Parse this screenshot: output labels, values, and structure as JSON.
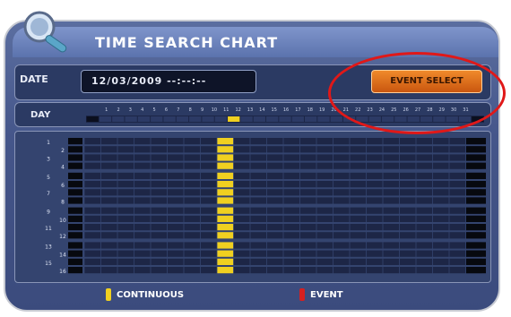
{
  "window": {
    "title": "TIME SEARCH CHART"
  },
  "date": {
    "label": "DATE",
    "value": "12/03/2009 --:--:--"
  },
  "event_select": {
    "label": "EVENT SELECT"
  },
  "day": {
    "label": "DAY",
    "numbers": [
      "1",
      "2",
      "3",
      "4",
      "5",
      "6",
      "7",
      "8",
      "9",
      "10",
      "11",
      "12",
      "13",
      "14",
      "15",
      "16",
      "17",
      "18",
      "19",
      "20",
      "21",
      "22",
      "23",
      "24",
      "25",
      "26",
      "27",
      "28",
      "29",
      "30",
      "31"
    ],
    "selected_day": "12"
  },
  "channels": {
    "labels": [
      "1",
      "2",
      "3",
      "4",
      "5",
      "6",
      "7",
      "8",
      "9",
      "10",
      "11",
      "12",
      "13",
      "14",
      "15",
      "16"
    ]
  },
  "legend": {
    "continuous_label": "CONTINUOUS",
    "event_label": "EVENT",
    "continuous_color": "#f0d020",
    "event_color": "#d62020"
  },
  "recording": {
    "hours": 24,
    "continuous_hour": 8
  }
}
